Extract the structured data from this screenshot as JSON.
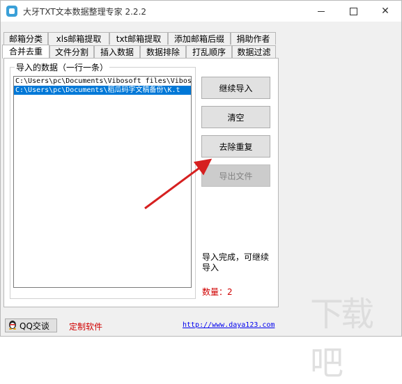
{
  "window": {
    "title": "大牙TXT文本数据整理专家 2.2.2"
  },
  "tabs": {
    "row1": [
      "邮箱分类",
      "xls邮箱提取",
      "txt邮箱提取",
      "添加邮箱后缀",
      "捐助作者"
    ],
    "row2": [
      "合并去重",
      "文件分割",
      "插入数据",
      "数据排除",
      "打乱顺序",
      "数据过滤"
    ],
    "active": "合并去重"
  },
  "import": {
    "group_title": "导入的数据（一行一条）",
    "items": [
      "C:\\Users\\pc\\Documents\\Vibosoft files\\Vibos",
      "C:\\Users\\pc\\Documents\\稻瓜码字文稿备份\\K.t"
    ]
  },
  "buttons": {
    "continue_import": "继续导入",
    "clear": "清空",
    "dedupe": "去除重复",
    "export": "导出文件"
  },
  "status": {
    "message": "导入完成，可继续导入",
    "count": "数量：2"
  },
  "footer": {
    "qq": "QQ交谈",
    "custom": "定制软件",
    "site": "http://www.daya123.com"
  },
  "colors": {
    "selection": "#0078d7",
    "accent_red": "#d00000",
    "link": "#0000ee",
    "arrow": "#d62020"
  }
}
